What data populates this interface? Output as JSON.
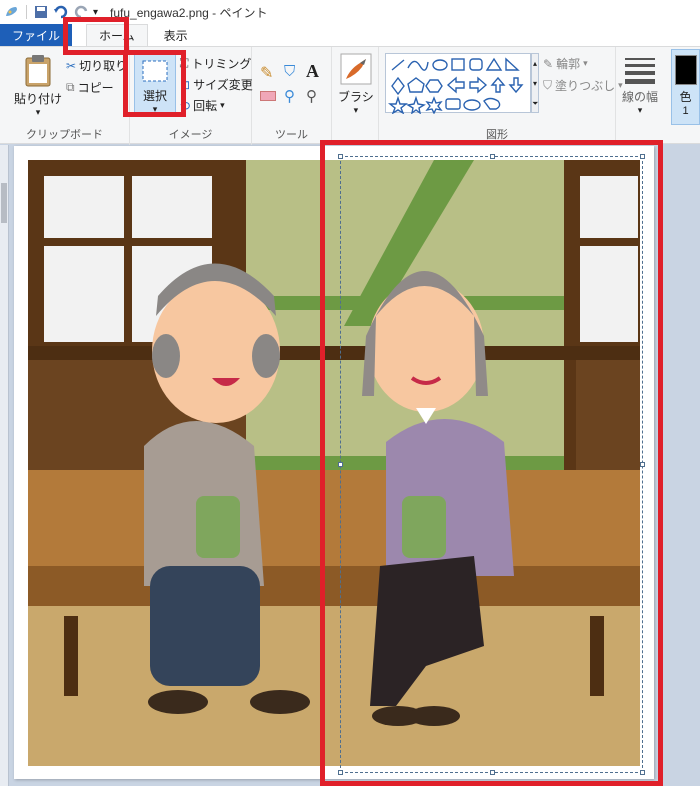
{
  "window": {
    "title": "fufu_engawa2.png - ペイント"
  },
  "tabs": [
    {
      "label": "ファイル"
    },
    {
      "label": "ホーム"
    },
    {
      "label": "表示"
    }
  ],
  "ribbon": {
    "clipboard": {
      "paste": "貼り付け",
      "cut": "切り取り",
      "copy": "コピー",
      "group": "クリップボード"
    },
    "image": {
      "select": "選択",
      "crop": "トリミング",
      "resize": "サイズ変更",
      "rotate": "回転",
      "group": "イメージ"
    },
    "tools": {
      "group": "ツール"
    },
    "brush": {
      "label": "ブラシ"
    },
    "shapes": {
      "outline": "輪郭",
      "fill": "塗りつぶし",
      "group": "図形"
    },
    "size": {
      "label": "線の幅"
    },
    "color": {
      "label": "色",
      "sub": "1"
    }
  },
  "colors": {
    "accent_red": "#e0202a",
    "file_tab": "#1e5fb8",
    "canvas_bg": "#c9d4e3"
  }
}
